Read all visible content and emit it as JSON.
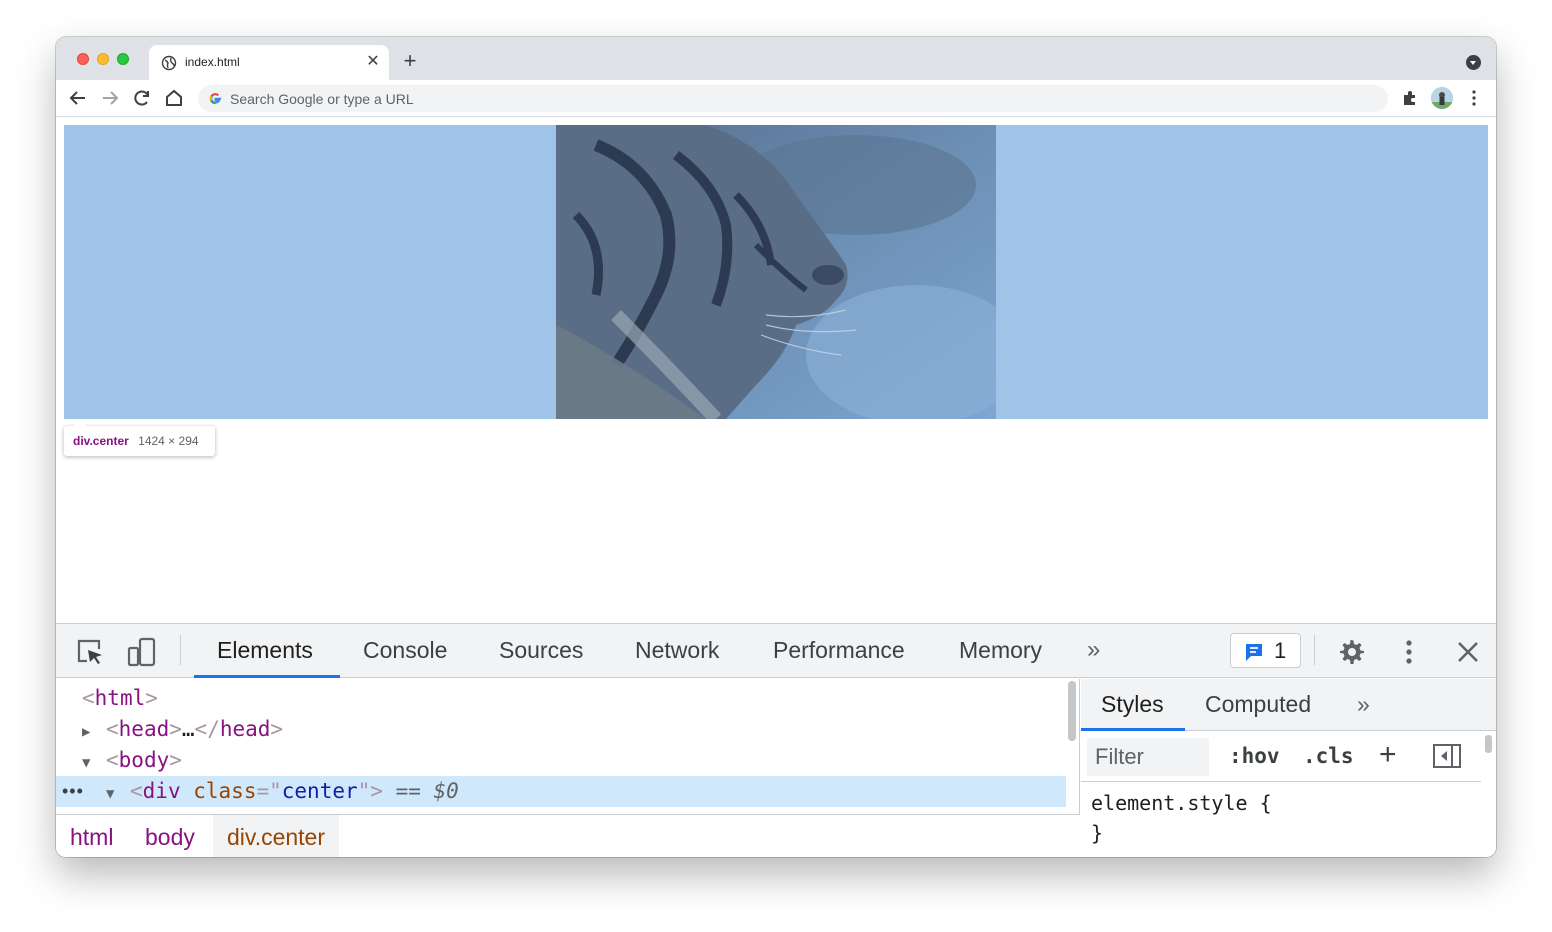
{
  "browser": {
    "tab_title": "index.html",
    "omnibox_placeholder": "Search Google or type a URL"
  },
  "inspect_tooltip": {
    "element": "div.center",
    "size": "1424 × 294"
  },
  "devtools": {
    "tabs": [
      "Elements",
      "Console",
      "Sources",
      "Network",
      "Performance",
      "Memory"
    ],
    "issues_count": "1",
    "dom": {
      "html_tag": "html",
      "head_tag": "head",
      "head_ellipsis": "…",
      "body_tag": "body",
      "div_tag": "div",
      "div_attr_name": "class",
      "div_attr_value": "center",
      "eq_marker": "==",
      "dollar_marker": "$0",
      "row_ellipsis": "•••"
    },
    "breadcrumbs": [
      "html",
      "body",
      "div.center"
    ],
    "styles_tabs": [
      "Styles",
      "Computed"
    ],
    "filter_placeholder": "Filter",
    "hov_label": ":hov",
    "cls_label": ".cls",
    "rule_selector": "element.style {",
    "rule_close": "}"
  },
  "colors": {
    "accent": "#1a73e8",
    "highlight": "#9fc4e7",
    "tag": "#881280",
    "attr": "#994500",
    "attr_value": "#1a1aa6"
  }
}
